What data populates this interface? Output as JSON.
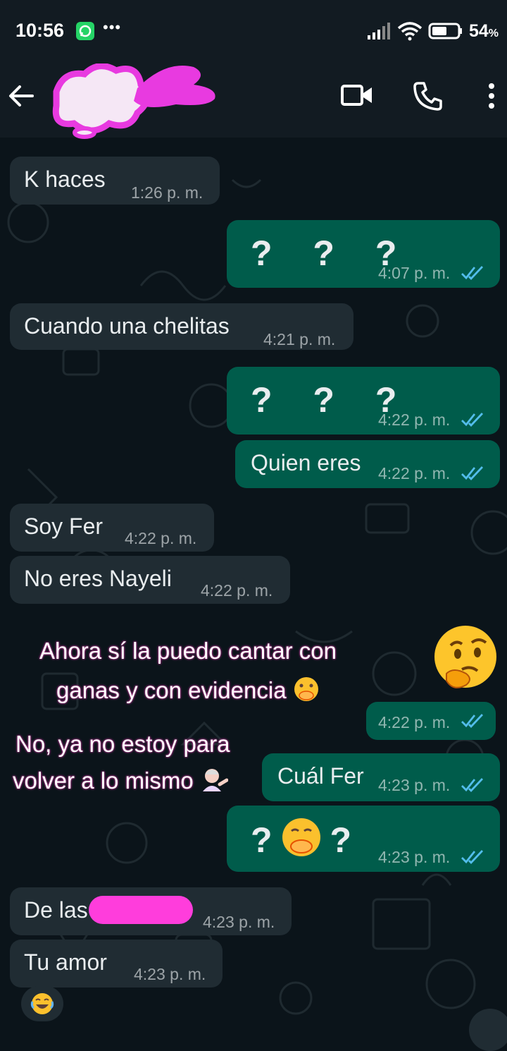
{
  "status_bar": {
    "time": "10:56",
    "battery": "54",
    "battery_unit": "%"
  },
  "chat": {
    "messages": [
      {
        "text": "K haces",
        "time": "1:26 p. m."
      },
      {
        "text": "? ? ?",
        "time": "4:07 p. m."
      },
      {
        "text": "Cuando una chelitas",
        "time": "4:21 p. m."
      },
      {
        "text": "? ? ?",
        "time": "4:22 p. m."
      },
      {
        "text": "Quien eres",
        "time": "4:22 p. m."
      },
      {
        "text": "Soy Fer",
        "time": "4:22 p. m."
      },
      {
        "text": "No eres Nayeli",
        "time": "4:22 p. m."
      },
      {
        "text": "",
        "time": "4:22 p. m."
      },
      {
        "text": "Cuál Fer",
        "time": "4:23 p. m."
      },
      {
        "q1": "?",
        "q2": "?",
        "time": "4:23 p. m."
      },
      {
        "text": "De las",
        "time": "4:23 p. m."
      },
      {
        "text": "Tu amor",
        "time": "4:23 p. m."
      }
    ]
  },
  "overlay": {
    "line1": "Ahora sí la puedo cantar con",
    "line2": "ganas y con evidencia",
    "line3": "No, ya no estoy para",
    "line4": "volver a lo mismo"
  },
  "colors": {
    "incoming": "#202c33",
    "outgoing": "#005c4b",
    "read_ticks": "#53bdeb",
    "redaction": "#ff3ddc"
  },
  "icons": [
    "back-arrow-icon",
    "video-call-icon",
    "phone-icon",
    "more-vert-icon",
    "whatsapp-notification-icon",
    "signal-icon",
    "wifi-icon",
    "battery-icon",
    "read-ticks-icon",
    "laughing-emoji",
    "thinking-emoji",
    "hand-over-mouth-emoji",
    "woman-tipping-hand-emoji"
  ]
}
